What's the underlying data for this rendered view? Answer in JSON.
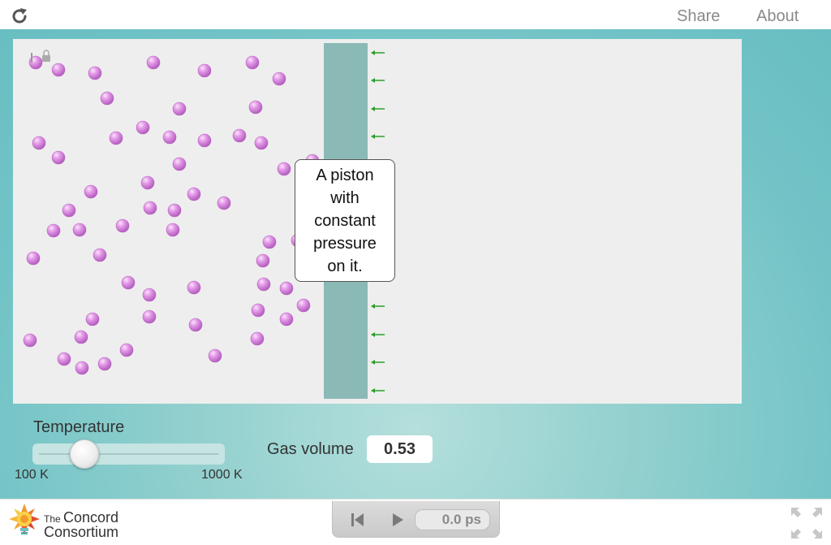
{
  "topbar": {
    "reload_icon": "reload-icon",
    "share_label": "Share",
    "about_label": "About"
  },
  "simulation": {
    "background_color": "#eeeeee",
    "piston_color": "#8bb9b6",
    "atom_color": "#d98be0",
    "arrow_color": "#2aa02a",
    "callout_lines": [
      "A piston",
      "with",
      "constant",
      "pressure",
      "on it."
    ]
  },
  "controls": {
    "temperature_label": "Temperature",
    "temperature_min_label": "100 K",
    "temperature_max_label": "1000 K",
    "temperature_fraction": 0.23,
    "gas_volume_label": "Gas volume",
    "gas_volume_value": "0.53"
  },
  "footer": {
    "logo_the": "The",
    "logo_line1": "Concord",
    "logo_line2": "Consortium",
    "time_display": "0.0 ps"
  }
}
